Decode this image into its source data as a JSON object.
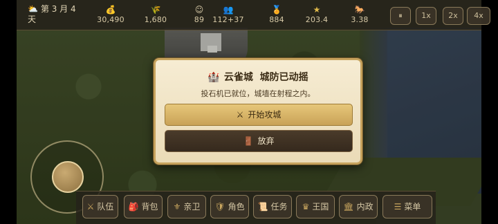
{
  "top_bar": {
    "day": {
      "icon": "sun-cloud-icon",
      "glyph": "⛅",
      "line1": "第 3 月 4",
      "line2": "天"
    },
    "stats": [
      {
        "name": "gold",
        "icon": "money-bag-icon",
        "glyph": "💰",
        "value": "30,490"
      },
      {
        "name": "food",
        "icon": "wheat-icon",
        "glyph": "🌾",
        "value": "1,680"
      },
      {
        "name": "morale",
        "icon": "smiley-icon",
        "glyph": "☺",
        "value": "89"
      },
      {
        "name": "troops",
        "icon": "people-icon",
        "glyph": "👥",
        "value": "112+37"
      },
      {
        "name": "renown",
        "icon": "medal-icon",
        "glyph": "🏅",
        "value": "884"
      },
      {
        "name": "prestige",
        "icon": "star-icon",
        "glyph": "★",
        "value": "203.4"
      },
      {
        "name": "speed",
        "icon": "horse-icon",
        "glyph": "🐎",
        "value": "3.38"
      }
    ],
    "speed_controls": {
      "pause": "⏸",
      "x1": "1x",
      "x2": "2x",
      "x4": "4x"
    }
  },
  "dialog": {
    "title_icon": "castle-icon",
    "title_glyph": "🏰",
    "title": "云雀城  城防已动摇",
    "message": "投石机已就位，城墙在射程之内。",
    "attack_button": {
      "icon": "crossed-swords-icon",
      "glyph": "⚔",
      "label": "开始攻城"
    },
    "quit_button": {
      "icon": "door-icon",
      "glyph": "🚪",
      "label": "放弃"
    }
  },
  "bottom_bar": [
    {
      "name": "party",
      "icon": "crossed-swords-icon",
      "glyph": "⚔",
      "label": "队伍"
    },
    {
      "name": "bag",
      "icon": "backpack-icon",
      "glyph": "🎒",
      "label": "背包"
    },
    {
      "name": "guard",
      "icon": "fleur-de-lis-icon",
      "glyph": "⚜",
      "label": "亲卫"
    },
    {
      "name": "character",
      "icon": "shield-icon",
      "glyph": "🛡",
      "label": "角色"
    },
    {
      "name": "quests",
      "icon": "scroll-icon",
      "glyph": "📜",
      "label": "任务"
    },
    {
      "name": "kingdom",
      "icon": "crown-icon",
      "glyph": "♛",
      "label": "王国"
    },
    {
      "name": "internal",
      "icon": "temple-icon",
      "glyph": "🏛",
      "label": "内政"
    },
    {
      "name": "menu",
      "icon": "hamburger-icon",
      "glyph": "☰",
      "label": "菜单"
    }
  ]
}
